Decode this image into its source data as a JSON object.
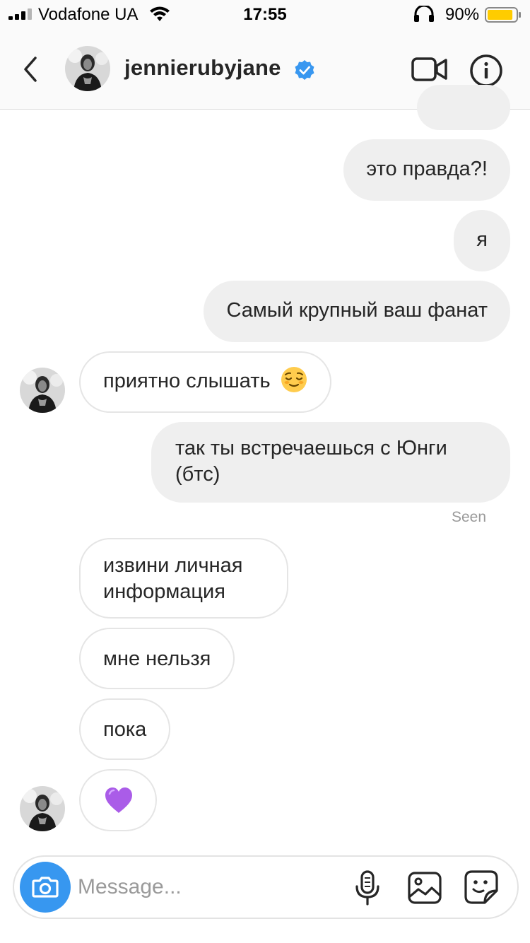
{
  "status_bar": {
    "carrier": "Vodafone UA",
    "time": "17:55",
    "battery_percent": "90%",
    "battery_level": 0.9,
    "battery_color": "#ffcc00"
  },
  "header": {
    "username": "jennierubyjane",
    "verified": true,
    "verified_color": "#3897f0",
    "icons": [
      "back-chevron-icon",
      "video-call-icon",
      "info-icon"
    ]
  },
  "messages": [
    {
      "side": "outgoing",
      "text": "это правда?!"
    },
    {
      "side": "outgoing",
      "text": "я"
    },
    {
      "side": "outgoing",
      "text": "Самый крупный ваш фанат"
    },
    {
      "side": "incoming",
      "text": "приятно слышать",
      "emoji": "relieved-face"
    },
    {
      "side": "outgoing",
      "text": "так ты встречаешься с Юнги (бтс)"
    },
    {
      "side": "incoming",
      "text": "извини личная информация"
    },
    {
      "side": "incoming",
      "text": "мне нельзя"
    },
    {
      "side": "incoming",
      "text": "пока"
    },
    {
      "side": "incoming",
      "emoji": "purple-heart"
    }
  ],
  "seen_label": "Seen",
  "composer": {
    "placeholder": "Message...",
    "camera_color": "#3797f0",
    "icons": [
      "camera-icon",
      "microphone-icon",
      "gallery-icon",
      "sticker-icon"
    ]
  }
}
